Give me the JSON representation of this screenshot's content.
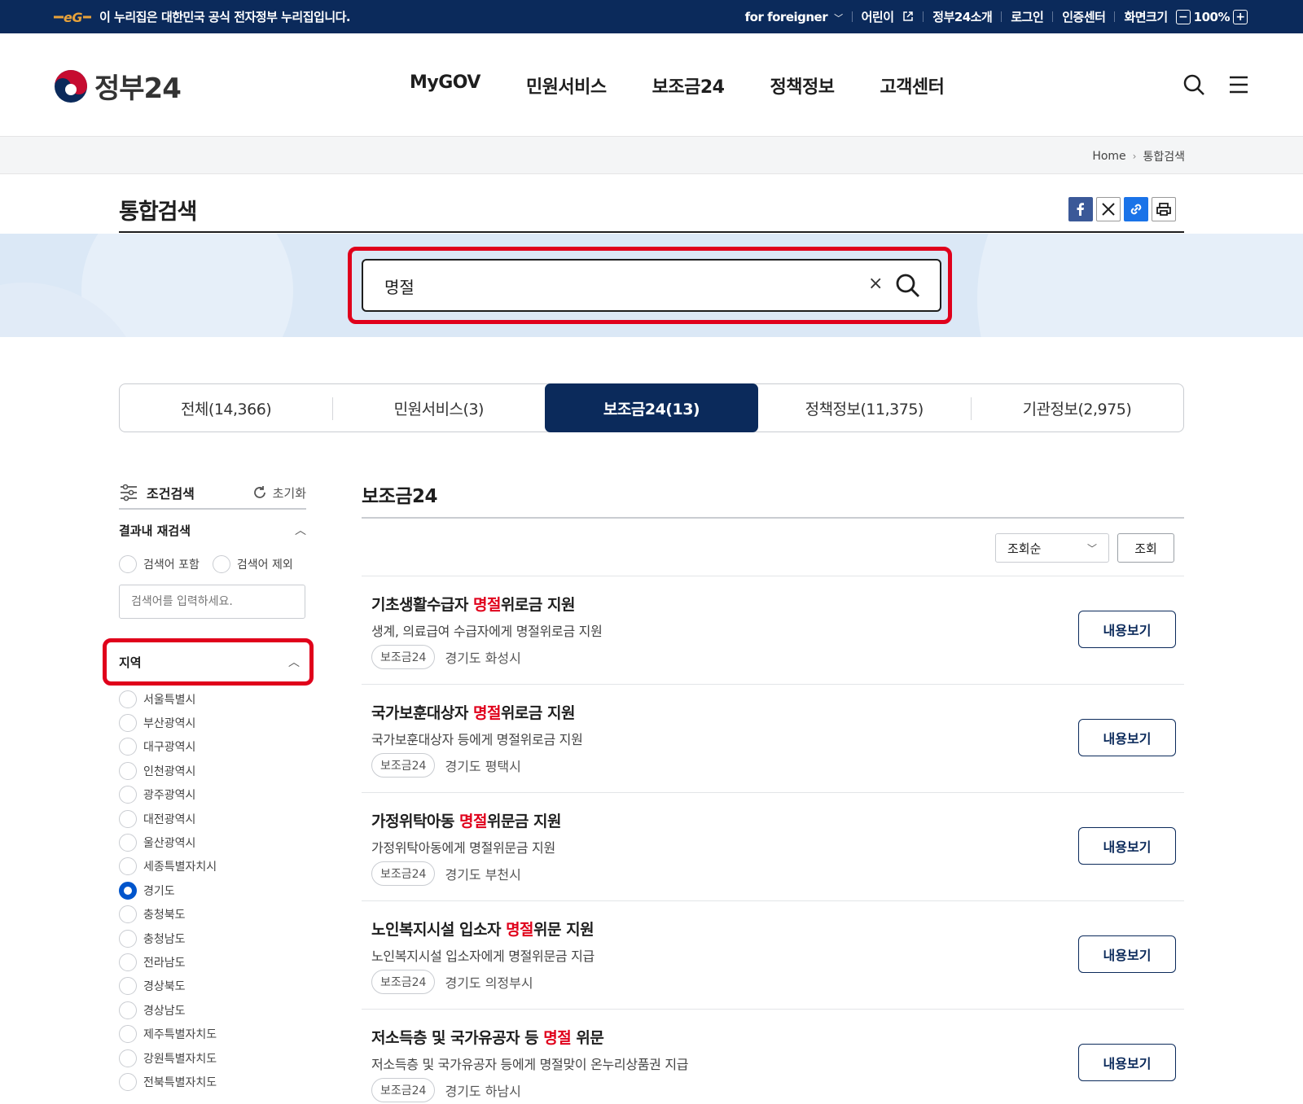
{
  "topbar": {
    "notice": "이 누리집은 대한민국 공식 전자정부 누리집입니다.",
    "foreigner": "for foreigner",
    "kids": "어린이",
    "about": "정부24소개",
    "login": "로그인",
    "cert": "인증센터",
    "screen_size": "화면크기",
    "zoom": "100%"
  },
  "header": {
    "logo_text": "정부24",
    "nav": [
      "MyGOV",
      "민원서비스",
      "보조금24",
      "정책정보",
      "고객센터"
    ]
  },
  "breadcrumb": {
    "home": "Home",
    "current": "통합검색"
  },
  "page_title": "통합검색",
  "search": {
    "value": "명절"
  },
  "tabs": [
    "전체(14,366)",
    "민원서비스(3)",
    "보조금24(13)",
    "정책정보(11,375)",
    "기관정보(2,975)"
  ],
  "sidebar": {
    "condition_search": "조건검색",
    "reset": "초기화",
    "refine_title": "결과내 재검색",
    "include": "검색어 포함",
    "exclude": "검색어 제외",
    "refine_placeholder": "검색어를 입력하세요.",
    "region_title": "지역",
    "regions": [
      "서울특별시",
      "부산광역시",
      "대구광역시",
      "인천광역시",
      "광주광역시",
      "대전광역시",
      "울산광역시",
      "세종특별자치시",
      "경기도",
      "충청북도",
      "충청남도",
      "전라남도",
      "경상북도",
      "경상남도",
      "제주특별자치도",
      "강원특별자치도",
      "전북특별자치도"
    ],
    "selected_region": "경기도"
  },
  "results": {
    "title": "보조금24",
    "sort": "조회순",
    "query_button": "조회",
    "view_button": "내용보기",
    "items": [
      {
        "pre": "기초생활수급자 ",
        "hl": "명절",
        "post": "위로금 지원",
        "desc": "생계, 의료급여 수급자에게 명절위로금 지원",
        "tag": "보조금24",
        "loc": "경기도 화성시"
      },
      {
        "pre": "국가보훈대상자 ",
        "hl": "명절",
        "post": "위로금 지원",
        "desc": "국가보훈대상자 등에게 명절위로금 지원",
        "tag": "보조금24",
        "loc": "경기도 평택시"
      },
      {
        "pre": "가정위탁아동 ",
        "hl": "명절",
        "post": "위문금 지원",
        "desc": "가정위탁아동에게 명절위문금 지원",
        "tag": "보조금24",
        "loc": "경기도 부천시"
      },
      {
        "pre": "노인복지시설 입소자 ",
        "hl": "명절",
        "post": "위문 지원",
        "desc": "노인복지시설 입소자에게 명절위문금 지급",
        "tag": "보조금24",
        "loc": "경기도 의정부시"
      },
      {
        "pre": "저소득층 및 국가유공자 등 ",
        "hl": "명절",
        "post": " 위문",
        "desc": "저소득층 및 국가유공자 등에게 명절맞이 온누리상품권 지급",
        "tag": "보조금24",
        "loc": "경기도 하남시"
      }
    ]
  },
  "colors": {
    "navy": "#0b2a5b",
    "highlight": "#e0001b",
    "band": "#dbe8f6",
    "radio_on": "#0055cc"
  },
  "icons": [
    "eg-logo-icon",
    "chevron-down-icon",
    "external-link-icon",
    "minus-icon",
    "plus-icon",
    "taegeuk-logo-icon",
    "search-icon",
    "menu-icon",
    "facebook-icon",
    "x-icon",
    "link-icon",
    "print-icon",
    "clear-icon",
    "filter-icon",
    "refresh-icon",
    "chevron-up-icon"
  ]
}
